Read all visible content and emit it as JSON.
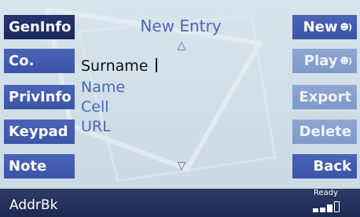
{
  "title": "New Entry",
  "left_buttons": [
    {
      "label": "GenInfo",
      "state": "active"
    },
    {
      "label": "Co.",
      "state": "normal"
    },
    {
      "label": "PrivInfo",
      "state": "normal"
    },
    {
      "label": "Keypad",
      "state": "normal"
    },
    {
      "label": "Note",
      "state": "normal"
    }
  ],
  "right_buttons": [
    {
      "label": "New",
      "icon": "person-speech-icon",
      "state": "normal"
    },
    {
      "label": "Play",
      "icon": "person-speech-icon",
      "state": "disabled"
    },
    {
      "label": "Export",
      "state": "disabled"
    },
    {
      "label": "Delete",
      "state": "disabled"
    },
    {
      "label": "Back",
      "state": "normal"
    }
  ],
  "fields": {
    "selected": "Surname",
    "others": [
      "Name",
      "Cell",
      "URL"
    ]
  },
  "status": {
    "label": "AddrBk",
    "ready": "Ready",
    "signal_bars_filled": 3,
    "signal_bars_total": 4
  },
  "colors": {
    "active_button": "#1f2d66",
    "button": "#4159ab",
    "disabled_button": "#889fcd",
    "accent_text": "#4a66b8",
    "status_bar": "#26325d"
  }
}
